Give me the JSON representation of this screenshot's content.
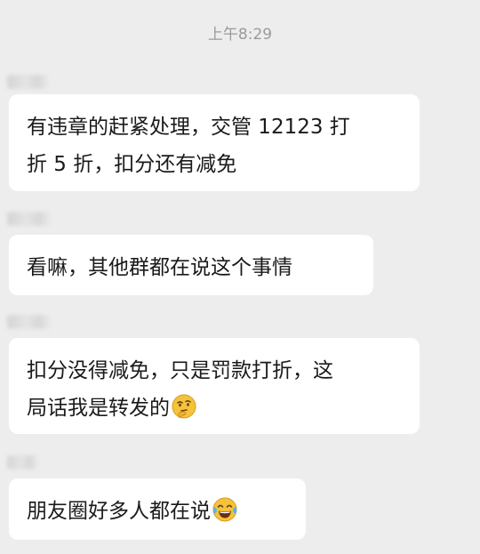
{
  "chat": {
    "timestamp": "上午8:29",
    "messages": [
      {
        "lines": [
          "有违章的赶紧处理，交管 12123 打",
          "折 5 折，扣分还有减免"
        ]
      },
      {
        "lines": [
          "看嘛，其他群都在说这个事情"
        ]
      },
      {
        "lines": [
          "扣分没得减免，只是罚款打折，这",
          "局话我是转发的"
        ],
        "emoji": "thinking-face-icon"
      },
      {
        "lines": [
          "朋友圈好多人都在说"
        ],
        "emoji": "tears-of-joy-icon"
      }
    ]
  },
  "colors": {
    "background": "#ededed",
    "bubble": "#ffffff",
    "text": "#1a1a1a",
    "timestamp": "#9a9a9a"
  }
}
